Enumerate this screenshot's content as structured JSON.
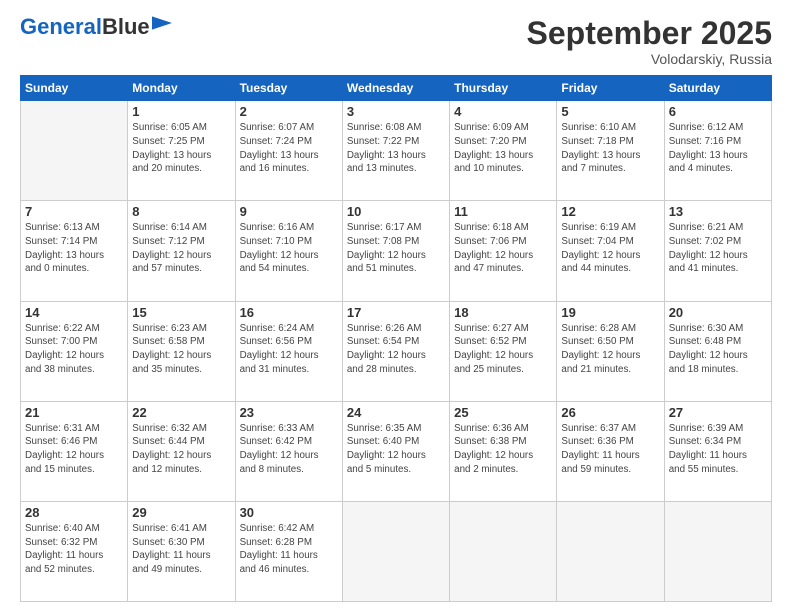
{
  "logo": {
    "part1": "General",
    "part2": "Blue"
  },
  "header": {
    "month": "September 2025",
    "location": "Volodarskiy, Russia"
  },
  "weekdays": [
    "Sunday",
    "Monday",
    "Tuesday",
    "Wednesday",
    "Thursday",
    "Friday",
    "Saturday"
  ],
  "weeks": [
    [
      {
        "day": "",
        "info": ""
      },
      {
        "day": "1",
        "info": "Sunrise: 6:05 AM\nSunset: 7:25 PM\nDaylight: 13 hours\nand 20 minutes."
      },
      {
        "day": "2",
        "info": "Sunrise: 6:07 AM\nSunset: 7:24 PM\nDaylight: 13 hours\nand 16 minutes."
      },
      {
        "day": "3",
        "info": "Sunrise: 6:08 AM\nSunset: 7:22 PM\nDaylight: 13 hours\nand 13 minutes."
      },
      {
        "day": "4",
        "info": "Sunrise: 6:09 AM\nSunset: 7:20 PM\nDaylight: 13 hours\nand 10 minutes."
      },
      {
        "day": "5",
        "info": "Sunrise: 6:10 AM\nSunset: 7:18 PM\nDaylight: 13 hours\nand 7 minutes."
      },
      {
        "day": "6",
        "info": "Sunrise: 6:12 AM\nSunset: 7:16 PM\nDaylight: 13 hours\nand 4 minutes."
      }
    ],
    [
      {
        "day": "7",
        "info": "Sunrise: 6:13 AM\nSunset: 7:14 PM\nDaylight: 13 hours\nand 0 minutes."
      },
      {
        "day": "8",
        "info": "Sunrise: 6:14 AM\nSunset: 7:12 PM\nDaylight: 12 hours\nand 57 minutes."
      },
      {
        "day": "9",
        "info": "Sunrise: 6:16 AM\nSunset: 7:10 PM\nDaylight: 12 hours\nand 54 minutes."
      },
      {
        "day": "10",
        "info": "Sunrise: 6:17 AM\nSunset: 7:08 PM\nDaylight: 12 hours\nand 51 minutes."
      },
      {
        "day": "11",
        "info": "Sunrise: 6:18 AM\nSunset: 7:06 PM\nDaylight: 12 hours\nand 47 minutes."
      },
      {
        "day": "12",
        "info": "Sunrise: 6:19 AM\nSunset: 7:04 PM\nDaylight: 12 hours\nand 44 minutes."
      },
      {
        "day": "13",
        "info": "Sunrise: 6:21 AM\nSunset: 7:02 PM\nDaylight: 12 hours\nand 41 minutes."
      }
    ],
    [
      {
        "day": "14",
        "info": "Sunrise: 6:22 AM\nSunset: 7:00 PM\nDaylight: 12 hours\nand 38 minutes."
      },
      {
        "day": "15",
        "info": "Sunrise: 6:23 AM\nSunset: 6:58 PM\nDaylight: 12 hours\nand 35 minutes."
      },
      {
        "day": "16",
        "info": "Sunrise: 6:24 AM\nSunset: 6:56 PM\nDaylight: 12 hours\nand 31 minutes."
      },
      {
        "day": "17",
        "info": "Sunrise: 6:26 AM\nSunset: 6:54 PM\nDaylight: 12 hours\nand 28 minutes."
      },
      {
        "day": "18",
        "info": "Sunrise: 6:27 AM\nSunset: 6:52 PM\nDaylight: 12 hours\nand 25 minutes."
      },
      {
        "day": "19",
        "info": "Sunrise: 6:28 AM\nSunset: 6:50 PM\nDaylight: 12 hours\nand 21 minutes."
      },
      {
        "day": "20",
        "info": "Sunrise: 6:30 AM\nSunset: 6:48 PM\nDaylight: 12 hours\nand 18 minutes."
      }
    ],
    [
      {
        "day": "21",
        "info": "Sunrise: 6:31 AM\nSunset: 6:46 PM\nDaylight: 12 hours\nand 15 minutes."
      },
      {
        "day": "22",
        "info": "Sunrise: 6:32 AM\nSunset: 6:44 PM\nDaylight: 12 hours\nand 12 minutes."
      },
      {
        "day": "23",
        "info": "Sunrise: 6:33 AM\nSunset: 6:42 PM\nDaylight: 12 hours\nand 8 minutes."
      },
      {
        "day": "24",
        "info": "Sunrise: 6:35 AM\nSunset: 6:40 PM\nDaylight: 12 hours\nand 5 minutes."
      },
      {
        "day": "25",
        "info": "Sunrise: 6:36 AM\nSunset: 6:38 PM\nDaylight: 12 hours\nand 2 minutes."
      },
      {
        "day": "26",
        "info": "Sunrise: 6:37 AM\nSunset: 6:36 PM\nDaylight: 11 hours\nand 59 minutes."
      },
      {
        "day": "27",
        "info": "Sunrise: 6:39 AM\nSunset: 6:34 PM\nDaylight: 11 hours\nand 55 minutes."
      }
    ],
    [
      {
        "day": "28",
        "info": "Sunrise: 6:40 AM\nSunset: 6:32 PM\nDaylight: 11 hours\nand 52 minutes."
      },
      {
        "day": "29",
        "info": "Sunrise: 6:41 AM\nSunset: 6:30 PM\nDaylight: 11 hours\nand 49 minutes."
      },
      {
        "day": "30",
        "info": "Sunrise: 6:42 AM\nSunset: 6:28 PM\nDaylight: 11 hours\nand 46 minutes."
      },
      {
        "day": "",
        "info": ""
      },
      {
        "day": "",
        "info": ""
      },
      {
        "day": "",
        "info": ""
      },
      {
        "day": "",
        "info": ""
      }
    ]
  ]
}
